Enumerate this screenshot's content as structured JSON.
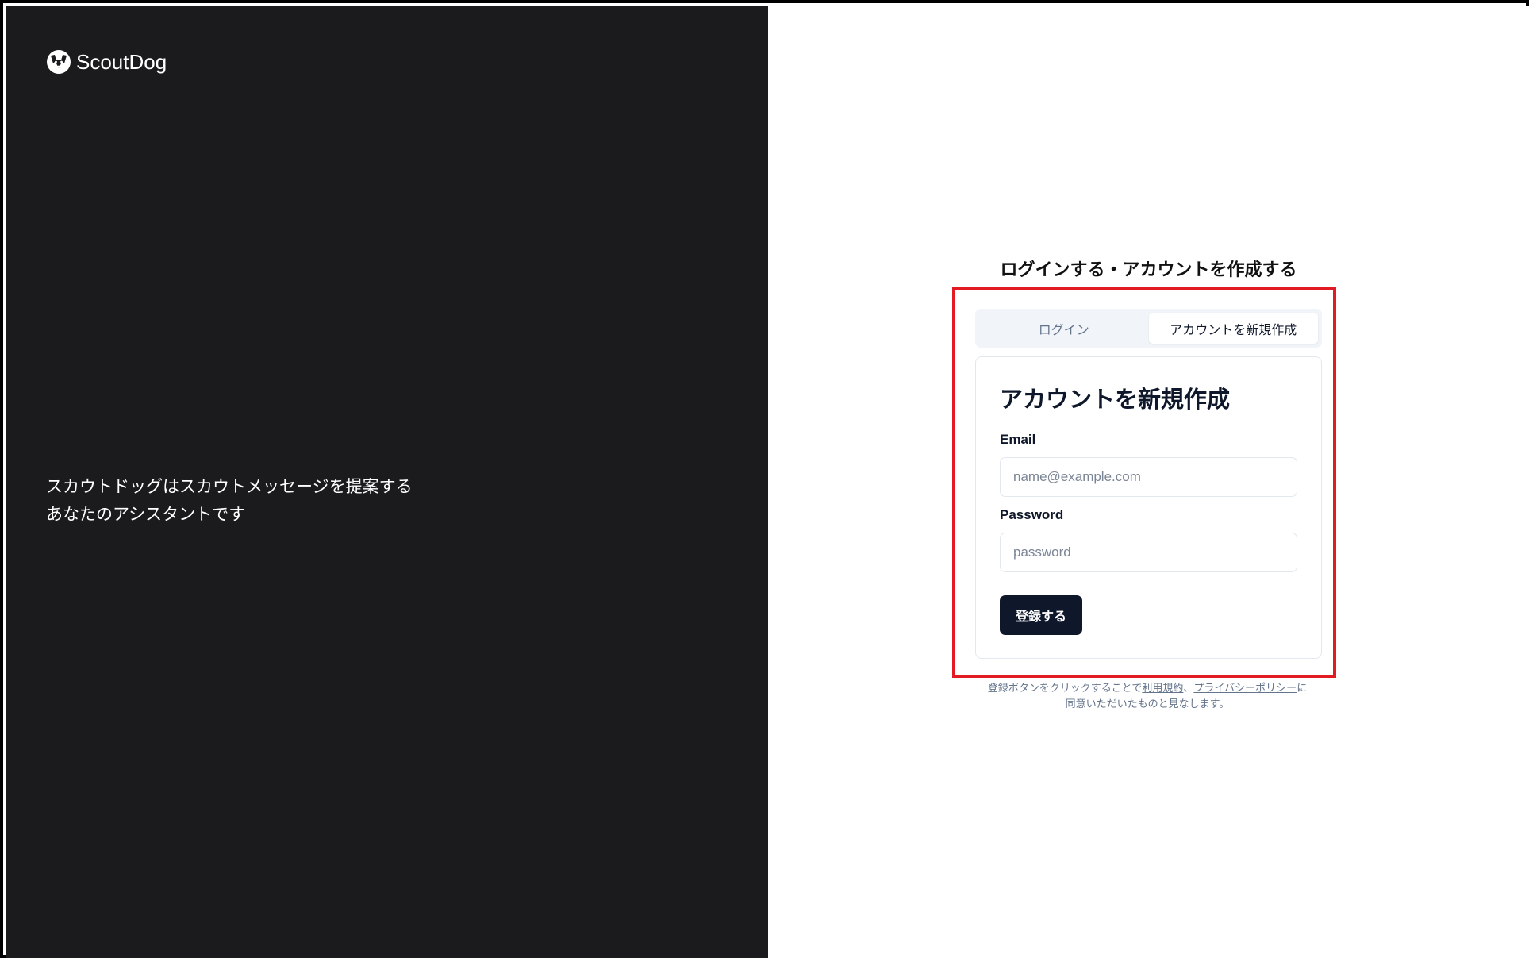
{
  "brand": {
    "name": "ScoutDog",
    "icon": "dog-face-icon"
  },
  "tagline": {
    "line1": "スカウトドッグはスカウトメッセージを提案する",
    "line2": "あなたのアシスタントです"
  },
  "page_heading": "ログインする・アカウントを作成する",
  "tabs": [
    {
      "label": "ログイン",
      "active": false
    },
    {
      "label": "アカウントを新規作成",
      "active": true
    }
  ],
  "form": {
    "title": "アカウントを新規作成",
    "email_label": "Email",
    "email_placeholder": "name@example.com",
    "email_value": "",
    "password_label": "Password",
    "password_placeholder": "password",
    "password_value": "",
    "submit_label": "登録する"
  },
  "terms": {
    "prefix": "登録ボタンをクリックすることで",
    "terms_link": "利用規約",
    "separator": "、",
    "privacy_link": "プライバシーポリシー",
    "suffix": "に同意いただいたものと見なします。"
  },
  "colors": {
    "left_panel_bg": "#1b1b1d",
    "highlight_border": "#e21b23",
    "primary_button": "#0f172a"
  }
}
